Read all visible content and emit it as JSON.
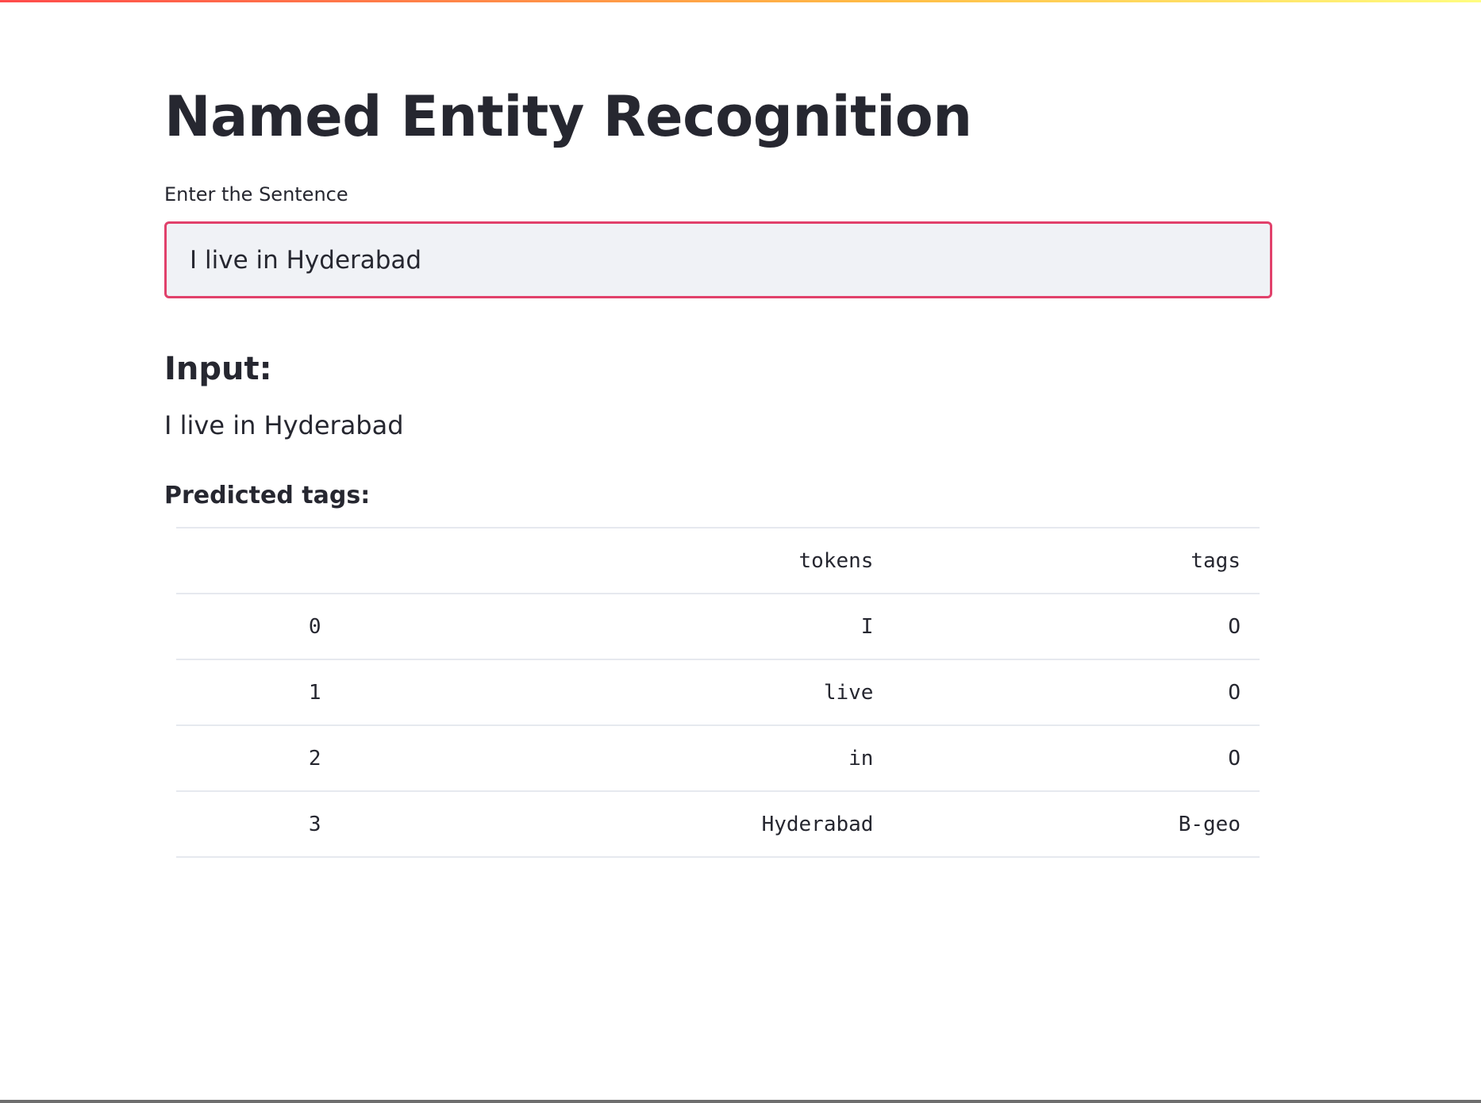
{
  "app": {
    "title": "Named Entity Recognition"
  },
  "input": {
    "label": "Enter the Sentence",
    "value": "I live in Hyderabad"
  },
  "output": {
    "input_heading": "Input:",
    "input_text": "I live in Hyderabad",
    "tags_heading": "Predicted tags:"
  },
  "table": {
    "columns": [
      "",
      "tokens",
      "tags"
    ],
    "rows": [
      {
        "index": "0",
        "token": "I",
        "tag": "O"
      },
      {
        "index": "1",
        "token": "live",
        "tag": "O"
      },
      {
        "index": "2",
        "token": "in",
        "tag": "O"
      },
      {
        "index": "3",
        "token": "Hyderabad",
        "tag": "B-geo"
      }
    ]
  },
  "colors": {
    "focus_border": "#e1416b",
    "input_background": "#f0f2f6",
    "text": "#262730"
  }
}
